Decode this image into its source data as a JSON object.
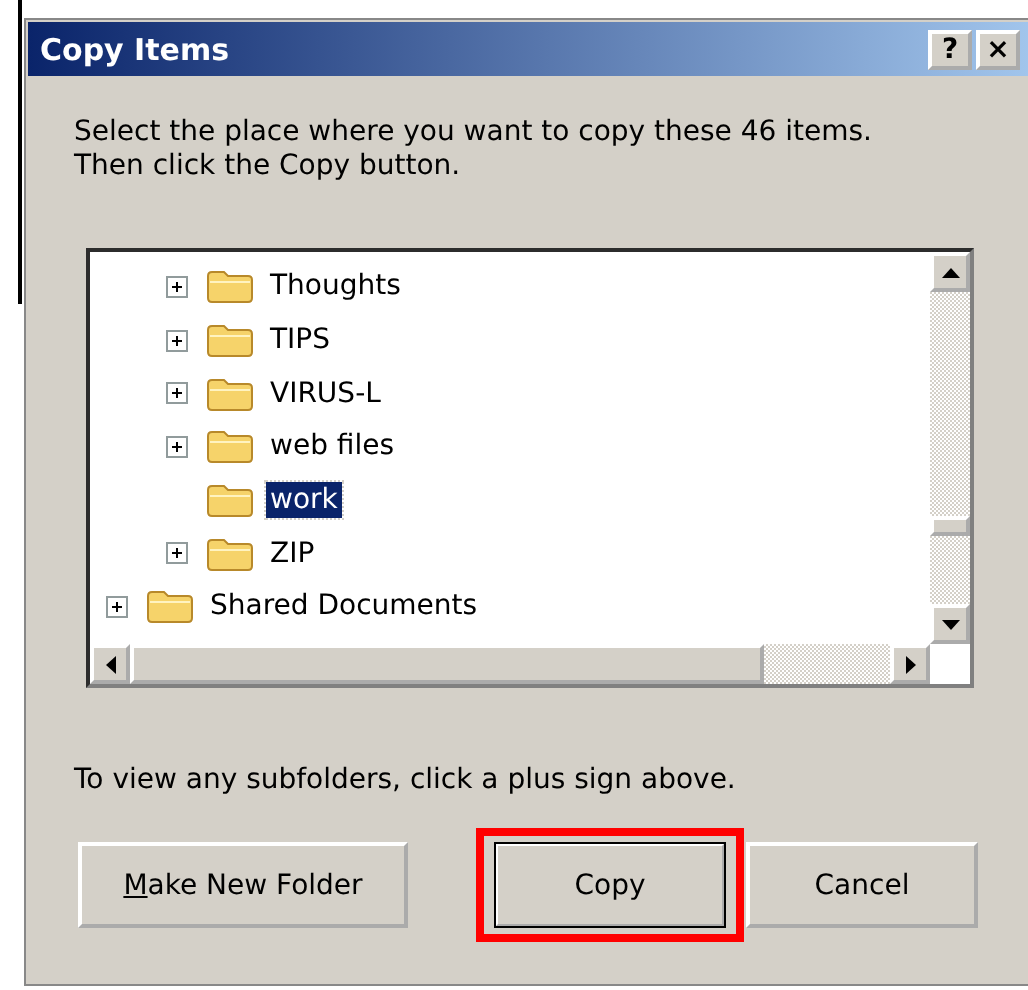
{
  "window": {
    "title": "Copy Items",
    "title_buttons": [
      "?",
      "×"
    ]
  },
  "instructions": [
    "Select the place where you want to copy these 46 items.",
    "Then click the Copy button."
  ],
  "tree": [
    {
      "children": [
        {
          "label": "Thoughts",
          "expandable": true,
          "selected": false
        },
        {
          "label": "TIPS",
          "expandable": true,
          "selected": false
        },
        {
          "label": "VIRUS-L",
          "expandable": true,
          "selected": false
        },
        {
          "label": "web files",
          "expandable": true,
          "selected": false
        },
        {
          "label": "work",
          "expandable": false,
          "selected": true
        },
        {
          "label": "ZIP",
          "expandable": true,
          "selected": false
        }
      ]
    },
    {
      "label": "Shared Documents",
      "expandable": true,
      "selected": false
    }
  ],
  "hint": "To view any subfolders, click a plus sign above.",
  "buttons": [
    {
      "label": "Make New Folder",
      "mnemonic_underlined": true,
      "highlighted": false,
      "default": false
    },
    {
      "label": "Copy",
      "highlighted": true,
      "default": true
    },
    {
      "label": "Cancel",
      "highlighted": false,
      "default": false
    }
  ]
}
